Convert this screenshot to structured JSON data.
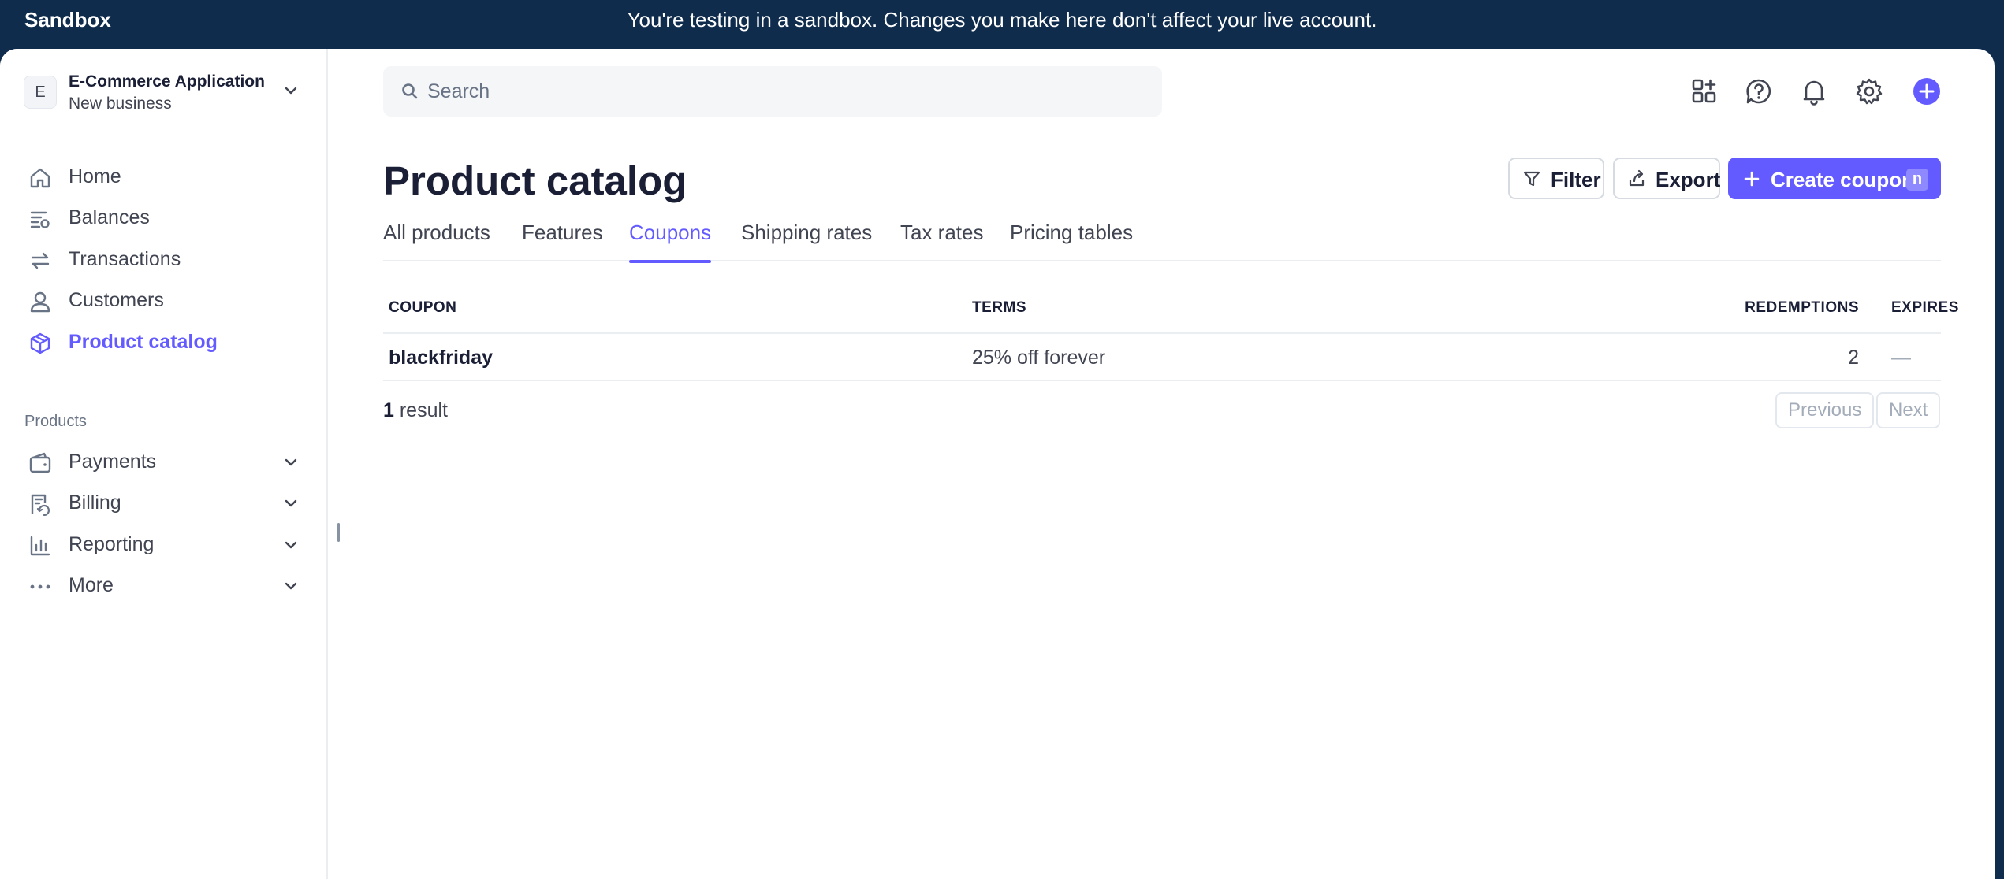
{
  "banner": {
    "label": "Sandbox",
    "message": "You're testing in a sandbox. Changes you make here don't affect your live account."
  },
  "account": {
    "initial": "E",
    "name": "E-Commerce Application",
    "subtitle": "New business"
  },
  "sidebar": {
    "items": [
      {
        "label": "Home",
        "icon": "home-icon"
      },
      {
        "label": "Balances",
        "icon": "balances-icon"
      },
      {
        "label": "Transactions",
        "icon": "transactions-icon"
      },
      {
        "label": "Customers",
        "icon": "customers-icon"
      },
      {
        "label": "Product catalog",
        "icon": "product-catalog-icon",
        "active": true
      }
    ],
    "section_label": "Products",
    "product_items": [
      {
        "label": "Payments",
        "icon": "payments-icon"
      },
      {
        "label": "Billing",
        "icon": "billing-icon"
      },
      {
        "label": "Reporting",
        "icon": "reporting-icon"
      },
      {
        "label": "More",
        "icon": "more-icon"
      }
    ]
  },
  "search": {
    "placeholder": "Search"
  },
  "header_icons": [
    "apps-icon",
    "help-icon",
    "bell-icon",
    "gear-icon",
    "plus-icon"
  ],
  "page": {
    "title": "Product catalog",
    "filter_label": "Filter",
    "export_label": "Export",
    "create_label": "Create coupon",
    "create_shortcut": "n"
  },
  "tabs": [
    {
      "label": "All products"
    },
    {
      "label": "Features"
    },
    {
      "label": "Coupons",
      "active": true
    },
    {
      "label": "Shipping rates"
    },
    {
      "label": "Tax rates"
    },
    {
      "label": "Pricing tables"
    }
  ],
  "table": {
    "columns": [
      "COUPON",
      "TERMS",
      "REDEMPTIONS",
      "EXPIRES"
    ],
    "rows": [
      {
        "coupon": "blackfriday",
        "terms": "25% off forever",
        "redemptions": "2",
        "expires": "—"
      }
    ]
  },
  "footer": {
    "count": "1",
    "result_label": "result",
    "previous_label": "Previous",
    "next_label": "Next"
  },
  "colors": {
    "accent": "#635bff",
    "banner": "#0f2c4d"
  }
}
